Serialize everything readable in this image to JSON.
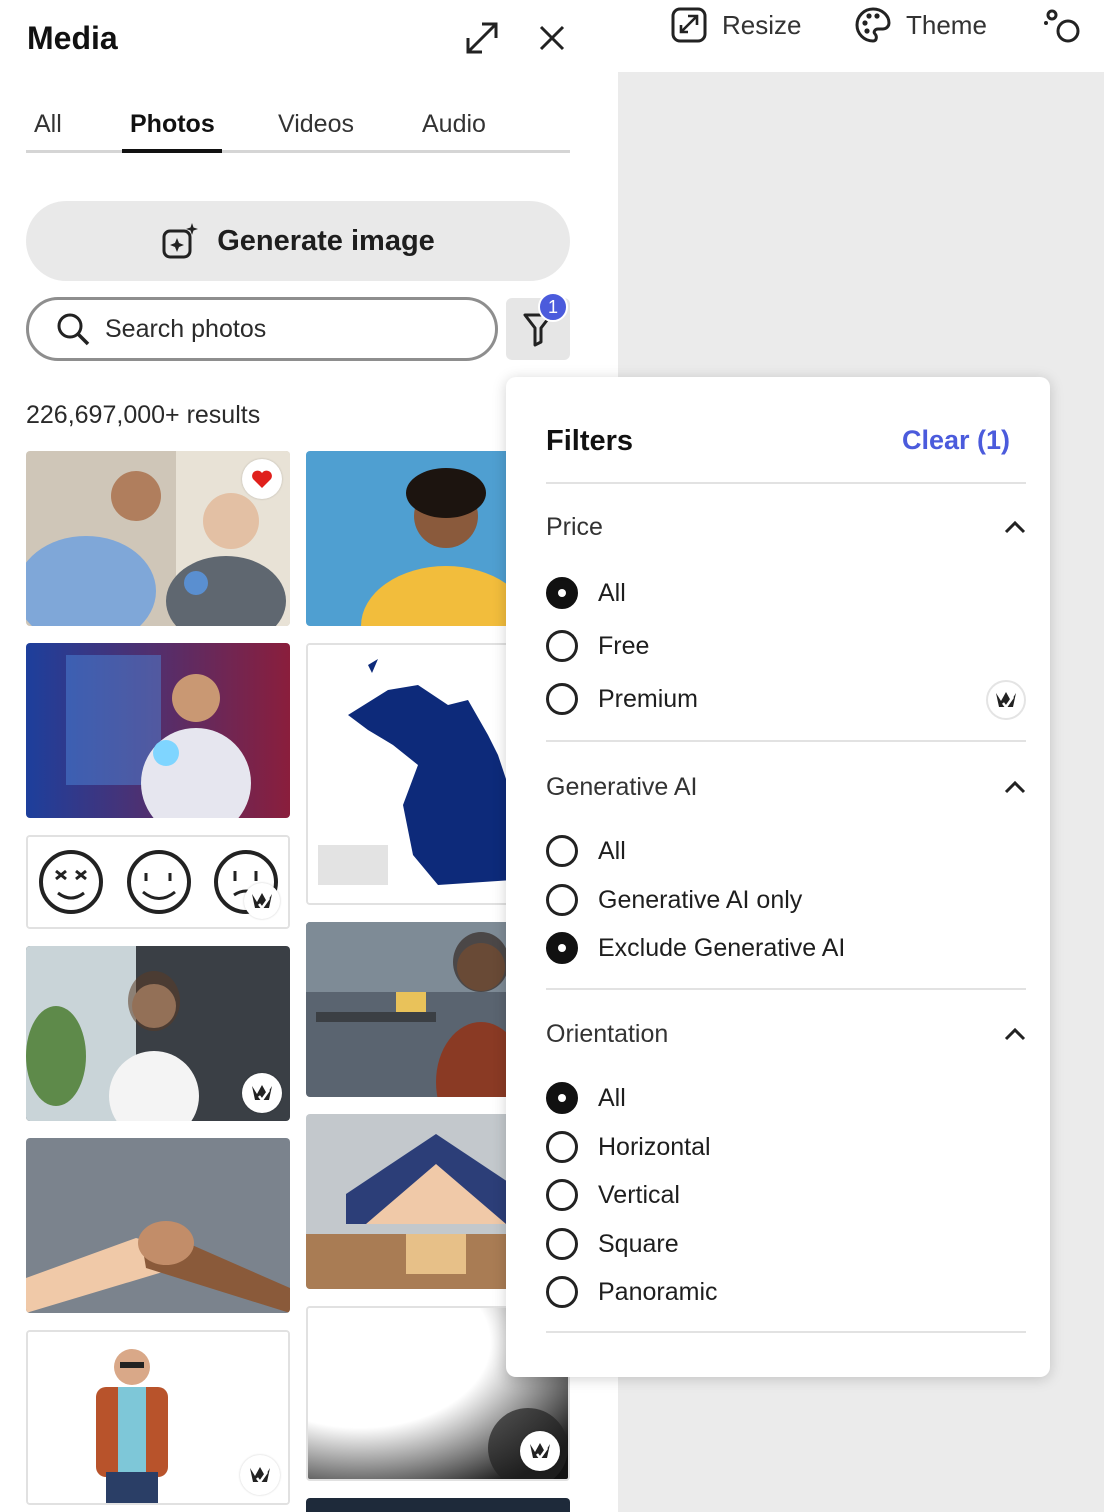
{
  "panel": {
    "title": "Media",
    "tabs": [
      "All",
      "Photos",
      "Videos",
      "Audio"
    ],
    "active_tab": "Photos",
    "generate_label": "Generate image",
    "search_placeholder": "Search photos",
    "filter_badge_count": "1",
    "results_count": "226,697,000+ results"
  },
  "toolbar": {
    "items": [
      {
        "label": "Resize",
        "icon": "resize-icon"
      },
      {
        "label": "Theme",
        "icon": "palette-icon"
      },
      {
        "label": "",
        "icon": "animate-icon"
      }
    ]
  },
  "filters": {
    "title": "Filters",
    "clear_label": "Clear (1)",
    "sections": [
      {
        "label": "Price",
        "expanded": true,
        "options": [
          {
            "label": "All",
            "checked": true
          },
          {
            "label": "Free",
            "checked": false
          },
          {
            "label": "Premium",
            "checked": false,
            "premium_icon": true
          }
        ]
      },
      {
        "label": "Generative AI",
        "expanded": true,
        "options": [
          {
            "label": "All",
            "checked": false
          },
          {
            "label": "Generative AI only",
            "checked": false
          },
          {
            "label": "Exclude Generative AI",
            "checked": true
          }
        ]
      },
      {
        "label": "Orientation",
        "expanded": true,
        "options": [
          {
            "label": "All",
            "checked": true
          },
          {
            "label": "Horizontal",
            "checked": false
          },
          {
            "label": "Vertical",
            "checked": false
          },
          {
            "label": "Square",
            "checked": false
          },
          {
            "label": "Panoramic",
            "checked": false
          }
        ]
      }
    ]
  },
  "colors": {
    "accent": "#4b5bdc",
    "favorite": "#e0201c",
    "panel_bg": "#ffffff",
    "canvas_bg": "#ebebeb"
  },
  "thumbnails": [
    {
      "subject": "nurse with elderly man",
      "badge": "favorite-heart-icon"
    },
    {
      "subject": "smiling man in yellow shirt",
      "badge": ""
    },
    {
      "subject": "man with holographic interface",
      "badge": ""
    },
    {
      "subject": "map of Michigan",
      "badge": ""
    },
    {
      "subject": "smiley faces doodles",
      "badge": "premium-crown-icon"
    },
    {
      "subject": "businesswoman arms crossed",
      "badge": "premium-crown-icon"
    },
    {
      "subject": "woman in office",
      "badge": ""
    },
    {
      "subject": "clasped hands",
      "badge": ""
    },
    {
      "subject": "hands protecting wooden family figures",
      "badge": ""
    },
    {
      "subject": "man with glasses holding tablet",
      "badge": "premium-crown-icon"
    },
    {
      "subject": "grunge texture",
      "badge": "premium-crown-icon"
    }
  ]
}
